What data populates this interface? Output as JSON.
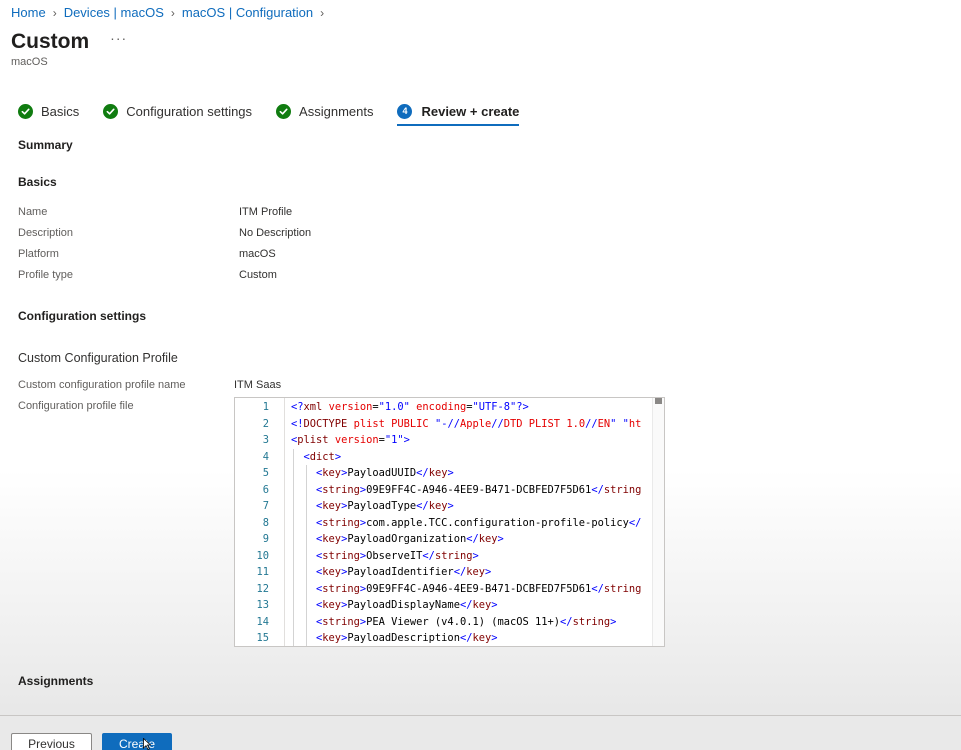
{
  "breadcrumb": [
    {
      "label": "Home"
    },
    {
      "label": "Devices | macOS"
    },
    {
      "label": "macOS | Configuration"
    }
  ],
  "header": {
    "title": "Custom",
    "more": "···",
    "subtitle": "macOS"
  },
  "steps": [
    {
      "label": "Basics",
      "state": "done"
    },
    {
      "label": "Configuration settings",
      "state": "done"
    },
    {
      "label": "Assignments",
      "state": "done"
    },
    {
      "label": "Review + create",
      "state": "active",
      "number": "4"
    }
  ],
  "summary": {
    "heading": "Summary",
    "basics_heading": "Basics",
    "basics": [
      {
        "label": "Name",
        "value": "ITM Profile"
      },
      {
        "label": "Description",
        "value": "No Description"
      },
      {
        "label": "Platform",
        "value": "macOS"
      },
      {
        "label": "Profile type",
        "value": "Custom"
      }
    ],
    "config_heading": "Configuration settings",
    "custom_heading": "Custom Configuration Profile",
    "profile_name_label": "Custom configuration profile name",
    "profile_name_value": "ITM Saas",
    "profile_file_label": "Configuration profile file",
    "assignments_heading": "Assignments"
  },
  "editor": {
    "lines": [
      {
        "n": "1",
        "tokens": [
          [
            "bracket",
            "<?"
          ],
          [
            "tag",
            "xml"
          ],
          [
            "text",
            " "
          ],
          [
            "attr",
            "version"
          ],
          [
            "text",
            "="
          ],
          [
            "str",
            "\"1.0\""
          ],
          [
            "text",
            " "
          ],
          [
            "attr",
            "encoding"
          ],
          [
            "text",
            "="
          ],
          [
            "str",
            "\"UTF-8\""
          ],
          [
            "bracket",
            "?>"
          ]
        ]
      },
      {
        "n": "2",
        "tokens": [
          [
            "bracket",
            "<!"
          ],
          [
            "tag",
            "DOCTYPE"
          ],
          [
            "text",
            " "
          ],
          [
            "attr",
            "plist"
          ],
          [
            "text",
            " "
          ],
          [
            "attr",
            "PUBLIC"
          ],
          [
            "text",
            " "
          ],
          [
            "str",
            "\"-//"
          ],
          [
            "attr",
            "Apple"
          ],
          [
            "str",
            "//"
          ],
          [
            "attr",
            "DTD PLIST 1.0"
          ],
          [
            "str",
            "//"
          ],
          [
            "attr",
            "EN"
          ],
          [
            "str",
            "\""
          ],
          [
            "text",
            " "
          ],
          [
            "str",
            "\""
          ],
          [
            "attr",
            "ht"
          ]
        ]
      },
      {
        "n": "3",
        "tokens": [
          [
            "bracket",
            "<"
          ],
          [
            "tag",
            "plist"
          ],
          [
            "text",
            " "
          ],
          [
            "attr",
            "version"
          ],
          [
            "text",
            "="
          ],
          [
            "str",
            "\"1\""
          ],
          [
            "bracket",
            ">"
          ]
        ]
      },
      {
        "n": "4",
        "tokens": [
          [
            "text",
            "  "
          ],
          [
            "bracket",
            "<"
          ],
          [
            "tag",
            "dict"
          ],
          [
            "bracket",
            ">"
          ]
        ]
      },
      {
        "n": "5",
        "tokens": [
          [
            "text",
            "    "
          ],
          [
            "bracket",
            "<"
          ],
          [
            "tag",
            "key"
          ],
          [
            "bracket",
            ">"
          ],
          [
            "text",
            "PayloadUUID"
          ],
          [
            "bracket",
            "</"
          ],
          [
            "tag",
            "key"
          ],
          [
            "bracket",
            ">"
          ]
        ]
      },
      {
        "n": "6",
        "tokens": [
          [
            "text",
            "    "
          ],
          [
            "bracket",
            "<"
          ],
          [
            "tag",
            "string"
          ],
          [
            "bracket",
            ">"
          ],
          [
            "text",
            "09E9FF4C-A946-4EE9-B471-DCBFED7F5D61"
          ],
          [
            "bracket",
            "</"
          ],
          [
            "tag",
            "string"
          ]
        ]
      },
      {
        "n": "7",
        "tokens": [
          [
            "text",
            "    "
          ],
          [
            "bracket",
            "<"
          ],
          [
            "tag",
            "key"
          ],
          [
            "bracket",
            ">"
          ],
          [
            "text",
            "PayloadType"
          ],
          [
            "bracket",
            "</"
          ],
          [
            "tag",
            "key"
          ],
          [
            "bracket",
            ">"
          ]
        ]
      },
      {
        "n": "8",
        "tokens": [
          [
            "text",
            "    "
          ],
          [
            "bracket",
            "<"
          ],
          [
            "tag",
            "string"
          ],
          [
            "bracket",
            ">"
          ],
          [
            "text",
            "com.apple.TCC.configuration-profile-policy"
          ],
          [
            "bracket",
            "</"
          ]
        ]
      },
      {
        "n": "9",
        "tokens": [
          [
            "text",
            "    "
          ],
          [
            "bracket",
            "<"
          ],
          [
            "tag",
            "key"
          ],
          [
            "bracket",
            ">"
          ],
          [
            "text",
            "PayloadOrganization"
          ],
          [
            "bracket",
            "</"
          ],
          [
            "tag",
            "key"
          ],
          [
            "bracket",
            ">"
          ]
        ]
      },
      {
        "n": "10",
        "tokens": [
          [
            "text",
            "    "
          ],
          [
            "bracket",
            "<"
          ],
          [
            "tag",
            "string"
          ],
          [
            "bracket",
            ">"
          ],
          [
            "text",
            "ObserveIT"
          ],
          [
            "bracket",
            "</"
          ],
          [
            "tag",
            "string"
          ],
          [
            "bracket",
            ">"
          ]
        ]
      },
      {
        "n": "11",
        "tokens": [
          [
            "text",
            "    "
          ],
          [
            "bracket",
            "<"
          ],
          [
            "tag",
            "key"
          ],
          [
            "bracket",
            ">"
          ],
          [
            "text",
            "PayloadIdentifier"
          ],
          [
            "bracket",
            "</"
          ],
          [
            "tag",
            "key"
          ],
          [
            "bracket",
            ">"
          ]
        ]
      },
      {
        "n": "12",
        "tokens": [
          [
            "text",
            "    "
          ],
          [
            "bracket",
            "<"
          ],
          [
            "tag",
            "string"
          ],
          [
            "bracket",
            ">"
          ],
          [
            "text",
            "09E9FF4C-A946-4EE9-B471-DCBFED7F5D61"
          ],
          [
            "bracket",
            "</"
          ],
          [
            "tag",
            "string"
          ]
        ]
      },
      {
        "n": "13",
        "tokens": [
          [
            "text",
            "    "
          ],
          [
            "bracket",
            "<"
          ],
          [
            "tag",
            "key"
          ],
          [
            "bracket",
            ">"
          ],
          [
            "text",
            "PayloadDisplayName"
          ],
          [
            "bracket",
            "</"
          ],
          [
            "tag",
            "key"
          ],
          [
            "bracket",
            ">"
          ]
        ]
      },
      {
        "n": "14",
        "tokens": [
          [
            "text",
            "    "
          ],
          [
            "bracket",
            "<"
          ],
          [
            "tag",
            "string"
          ],
          [
            "bracket",
            ">"
          ],
          [
            "text",
            "PEA Viewer (v4.0.1) (macOS 11+)"
          ],
          [
            "bracket",
            "</"
          ],
          [
            "tag",
            "string"
          ],
          [
            "bracket",
            ">"
          ]
        ]
      },
      {
        "n": "15",
        "tokens": [
          [
            "text",
            "    "
          ],
          [
            "bracket",
            "<"
          ],
          [
            "tag",
            "key"
          ],
          [
            "bracket",
            ">"
          ],
          [
            "text",
            "PayloadDescription"
          ],
          [
            "bracket",
            "</"
          ],
          [
            "tag",
            "key"
          ],
          [
            "bracket",
            ">"
          ]
        ]
      }
    ]
  },
  "footer": {
    "previous_label": "Previous",
    "create_label": "Create"
  },
  "colors": {
    "accent": "#0f6cbd",
    "success": "#107c10"
  }
}
